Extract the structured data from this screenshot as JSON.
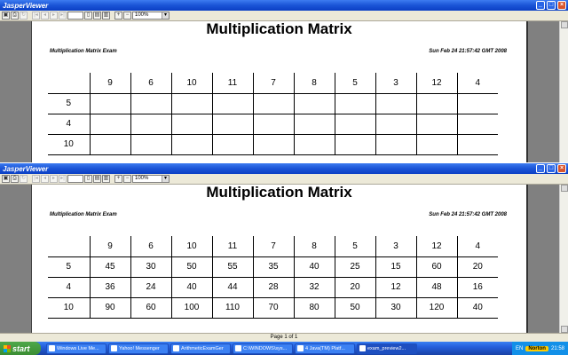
{
  "window_title": "JasperViewer",
  "zoom": "100%",
  "report": {
    "title": "Multiplication Matrix",
    "subtitle": "Multiplication Matrix Exam",
    "date": "Sun Feb 24 21:57:42 GMT 2008"
  },
  "columns": [
    "9",
    "6",
    "10",
    "11",
    "7",
    "8",
    "5",
    "3",
    "12",
    "4"
  ],
  "win1_rows": [
    {
      "label": "5",
      "cells": [
        "",
        "",
        "",
        "",
        "",
        "",
        "",
        "",
        "",
        ""
      ]
    },
    {
      "label": "4",
      "cells": [
        "",
        "",
        "",
        "",
        "",
        "",
        "",
        "",
        "",
        ""
      ]
    },
    {
      "label": "10",
      "cells": [
        "",
        "",
        "",
        "",
        "",
        "",
        "",
        "",
        "",
        ""
      ]
    }
  ],
  "win2_rows": [
    {
      "label": "5",
      "cells": [
        "45",
        "30",
        "50",
        "55",
        "35",
        "40",
        "25",
        "15",
        "60",
        "20"
      ]
    },
    {
      "label": "4",
      "cells": [
        "36",
        "24",
        "40",
        "44",
        "28",
        "32",
        "20",
        "12",
        "48",
        "16"
      ]
    },
    {
      "label": "10",
      "cells": [
        "90",
        "60",
        "100",
        "110",
        "70",
        "80",
        "50",
        "30",
        "120",
        "40"
      ]
    }
  ],
  "page_status": "Page 1 of 1",
  "taskbar": {
    "start": "start",
    "items": [
      "Windows Live Me...",
      "Yahoo! Messenger",
      "ArithmeticExamGer",
      "C:\\WINDOWS\\sys...",
      "4 Java(TM) Platf...",
      "exam_preview2..."
    ],
    "lang": "EN",
    "norton": "Norton",
    "clock": "21:58"
  },
  "colors": {
    "titlebar": "#1a54d6",
    "taskbar": "#245edb",
    "start": "#3b8d33"
  }
}
